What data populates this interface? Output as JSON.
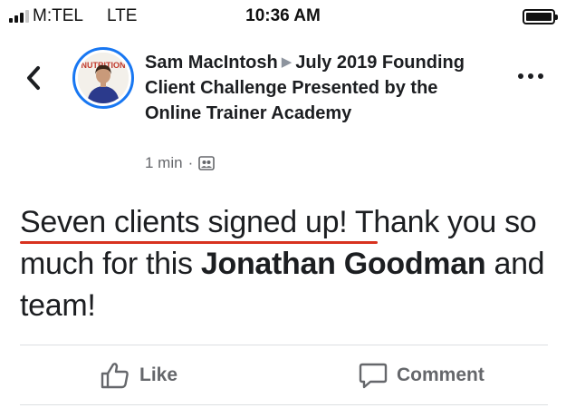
{
  "status_bar": {
    "carrier": "M:TEL",
    "network": "LTE",
    "time": "10:36 AM",
    "signal_bars_filled": 3,
    "signal_bars_total": 4,
    "battery_level": 1.0
  },
  "post": {
    "author": "Sam MacIntosh",
    "group": "July 2019 Founding Client Challenge Presented by the Online Trainer Academy",
    "timestamp": "1 min",
    "meta_separator": "·",
    "privacy_icon": "group-privacy-icon",
    "body": {
      "part1": "Seven clients signed up! Thank you so much for this ",
      "mention": "Jonathan Goodman",
      "part2": " and team!"
    },
    "avatar_text": "NUTRITION"
  },
  "actions": {
    "like_label": "Like",
    "comment_label": "Comment"
  },
  "colors": {
    "accent": "#1877f2",
    "underline": "#d8321f",
    "secondary_text": "#65676b"
  }
}
